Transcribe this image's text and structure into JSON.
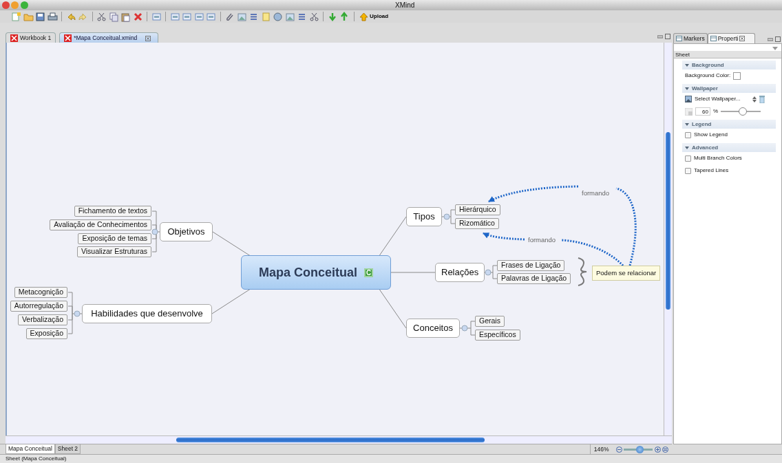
{
  "window": {
    "title": "XMind"
  },
  "toolbar": {
    "upload_label": "Upload"
  },
  "editor_tabs": [
    {
      "label": "Workbook 1",
      "selected": false
    },
    {
      "label": "*Mapa Conceitual.xmind",
      "selected": true
    }
  ],
  "map": {
    "central": "Mapa Conceitual",
    "central_marker": "C",
    "branches": [
      {
        "label": "Objetivos",
        "children": [
          "Fichamento de textos",
          "Avaliação de Conhecimentos",
          "Exposição de temas",
          "Visualizar Estruturas"
        ]
      },
      {
        "label": "Habilidades que desenvolve",
        "children": [
          "Metacognição",
          "Autorregulação",
          "Verbalização",
          "Exposição"
        ]
      },
      {
        "label": "Tipos",
        "children": [
          "Hierárquico",
          "Rizomático"
        ]
      },
      {
        "label": "Relações",
        "children": [
          "Frases de Ligação",
          "Palavras de Ligação"
        ]
      },
      {
        "label": "Conceitos",
        "children": [
          "Gerais",
          "Específicos"
        ]
      }
    ],
    "summary": "Podem se relacionar",
    "relationships": [
      {
        "label": "formando"
      },
      {
        "label": "formando"
      }
    ]
  },
  "sheet_tabs": [
    {
      "label": "Mapa Conceitual",
      "selected": true
    },
    {
      "label": "Sheet 2",
      "selected": false
    }
  ],
  "zoom": {
    "reading": "146%",
    "level": 0.55
  },
  "status_bar": "Sheet (Mapa Conceitual)",
  "panel": {
    "tabs": [
      {
        "label": "Markers",
        "selected": false
      },
      {
        "label": "Properti",
        "selected": true
      }
    ],
    "header": "Sheet",
    "sections": [
      {
        "title": "Background",
        "rows": [
          {
            "kind": "color",
            "label": "Background Color:"
          }
        ]
      },
      {
        "title": "Wallpaper",
        "rows": [
          {
            "kind": "select",
            "label": "Select Wallpaper..."
          },
          {
            "kind": "slider",
            "value": "60",
            "unit": "%",
            "level": 0.55
          }
        ]
      },
      {
        "title": "Legend",
        "rows": [
          {
            "kind": "checkbox",
            "label": "Show Legend",
            "checked": false
          }
        ]
      },
      {
        "title": "Advanced",
        "rows": [
          {
            "kind": "checkbox",
            "label": "Multi Branch Colors",
            "checked": false
          },
          {
            "kind": "checkbox",
            "label": "Tapered Lines",
            "checked": false
          }
        ]
      }
    ]
  }
}
